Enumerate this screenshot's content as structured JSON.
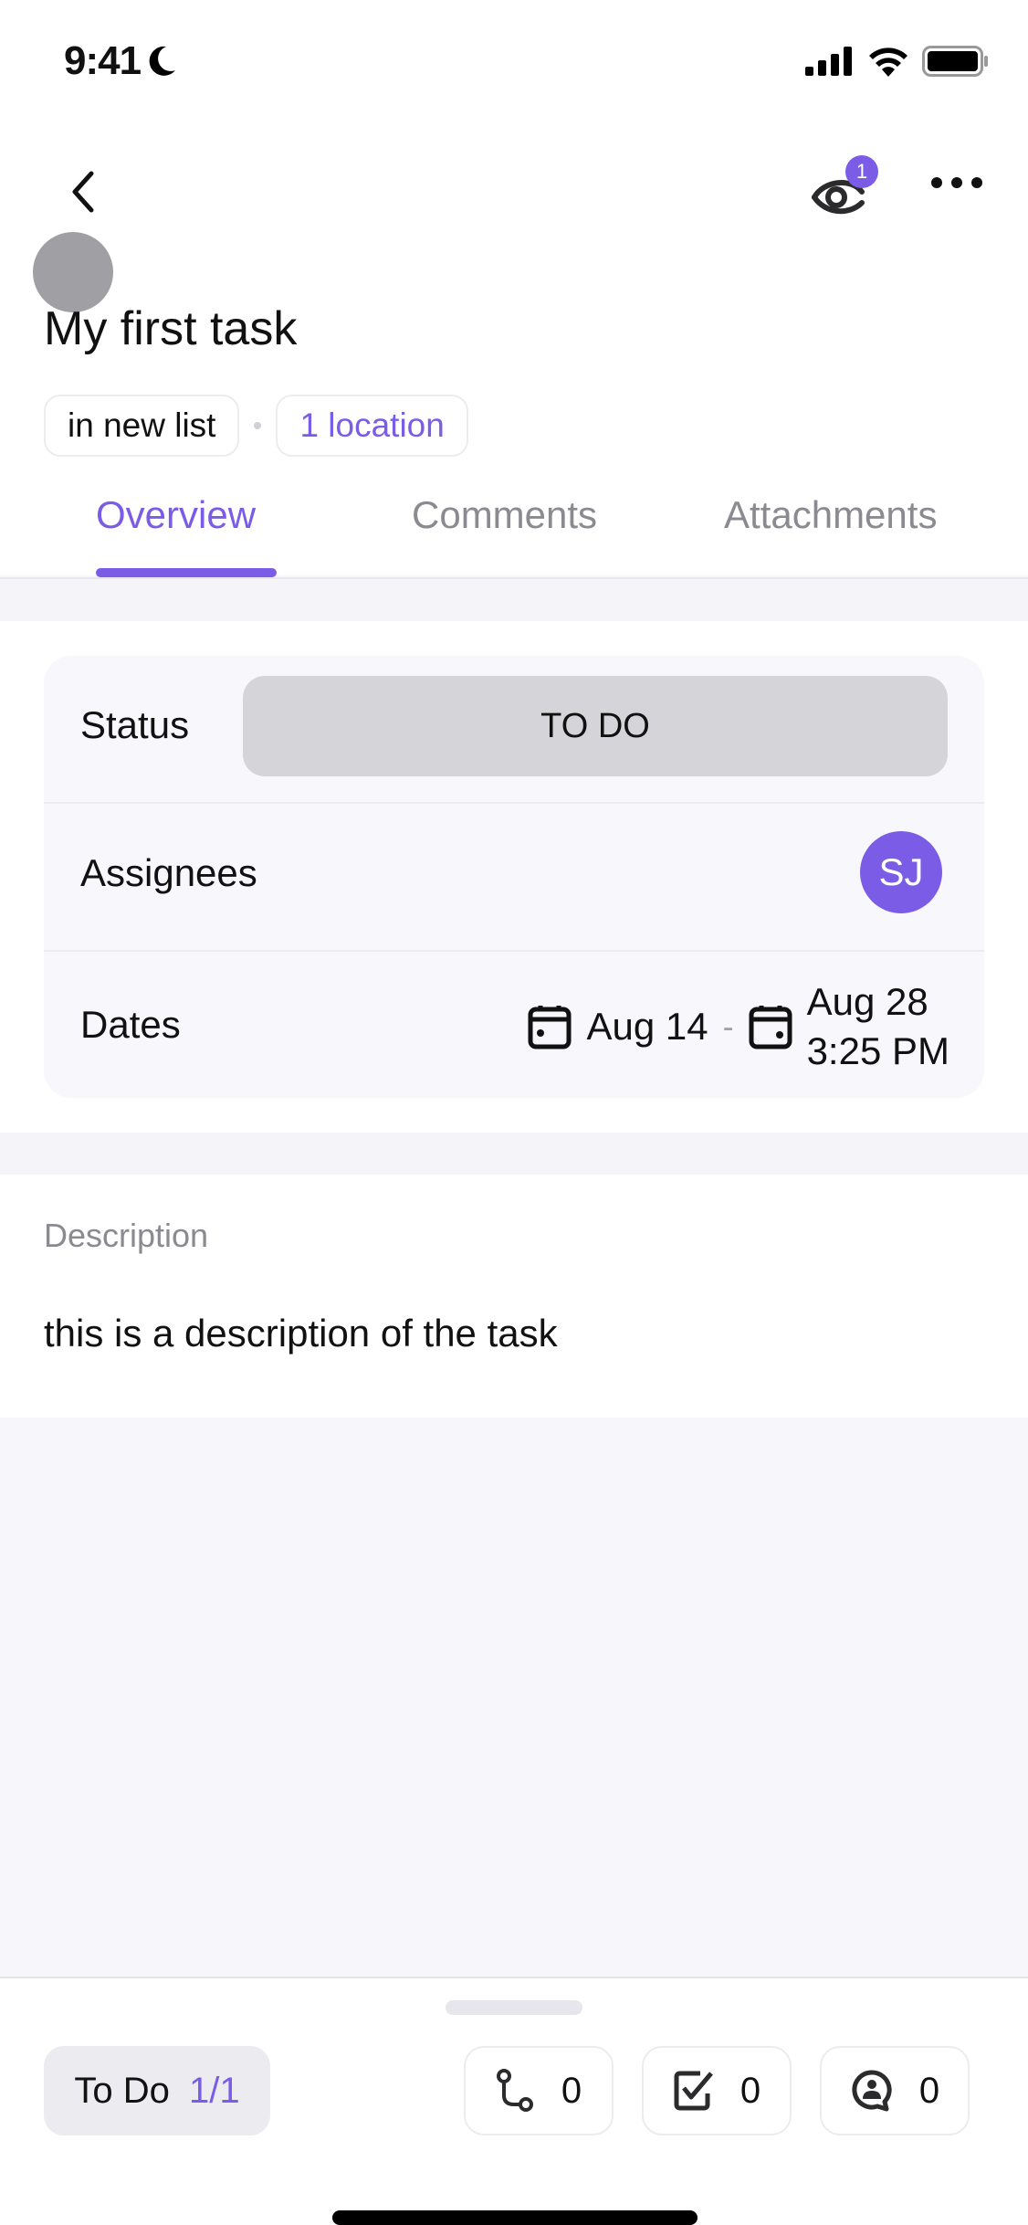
{
  "status_bar": {
    "time": "9:41",
    "icons": [
      "moon-icon",
      "cellular-signal-icon",
      "wifi-icon",
      "battery-icon"
    ]
  },
  "header": {
    "back_icon": "chevron-left-icon",
    "watchers_icon": "eye-icon",
    "watchers_count": "1",
    "more_icon": "more-horizontal-icon"
  },
  "task": {
    "title": "My first task",
    "list_chip": "in new list",
    "location_chip": "1 location"
  },
  "tabs": [
    {
      "label": "Overview",
      "active": true
    },
    {
      "label": "Comments",
      "active": false
    },
    {
      "label": "Attachments",
      "active": false
    }
  ],
  "details": {
    "status_label": "Status",
    "status_value": "TO DO",
    "assignees_label": "Assignees",
    "assignee_initials": "SJ",
    "dates_label": "Dates",
    "start_date": "Aug 14",
    "date_separator": "-",
    "due_date": "Aug 28",
    "due_time": "3:25 PM"
  },
  "description": {
    "label": "Description",
    "text": "this is a description of the task"
  },
  "bottom_bar": {
    "status_label": "To Do",
    "status_count": "1/1",
    "counters": [
      {
        "icon": "dependency-icon",
        "value": "0"
      },
      {
        "icon": "checklist-icon",
        "value": "0"
      },
      {
        "icon": "assigned-comments-icon",
        "value": "0"
      }
    ]
  },
  "colors": {
    "accent": "#7b5ce6",
    "status_pill": "#d5d4d8",
    "muted_text": "#8a8a90"
  }
}
